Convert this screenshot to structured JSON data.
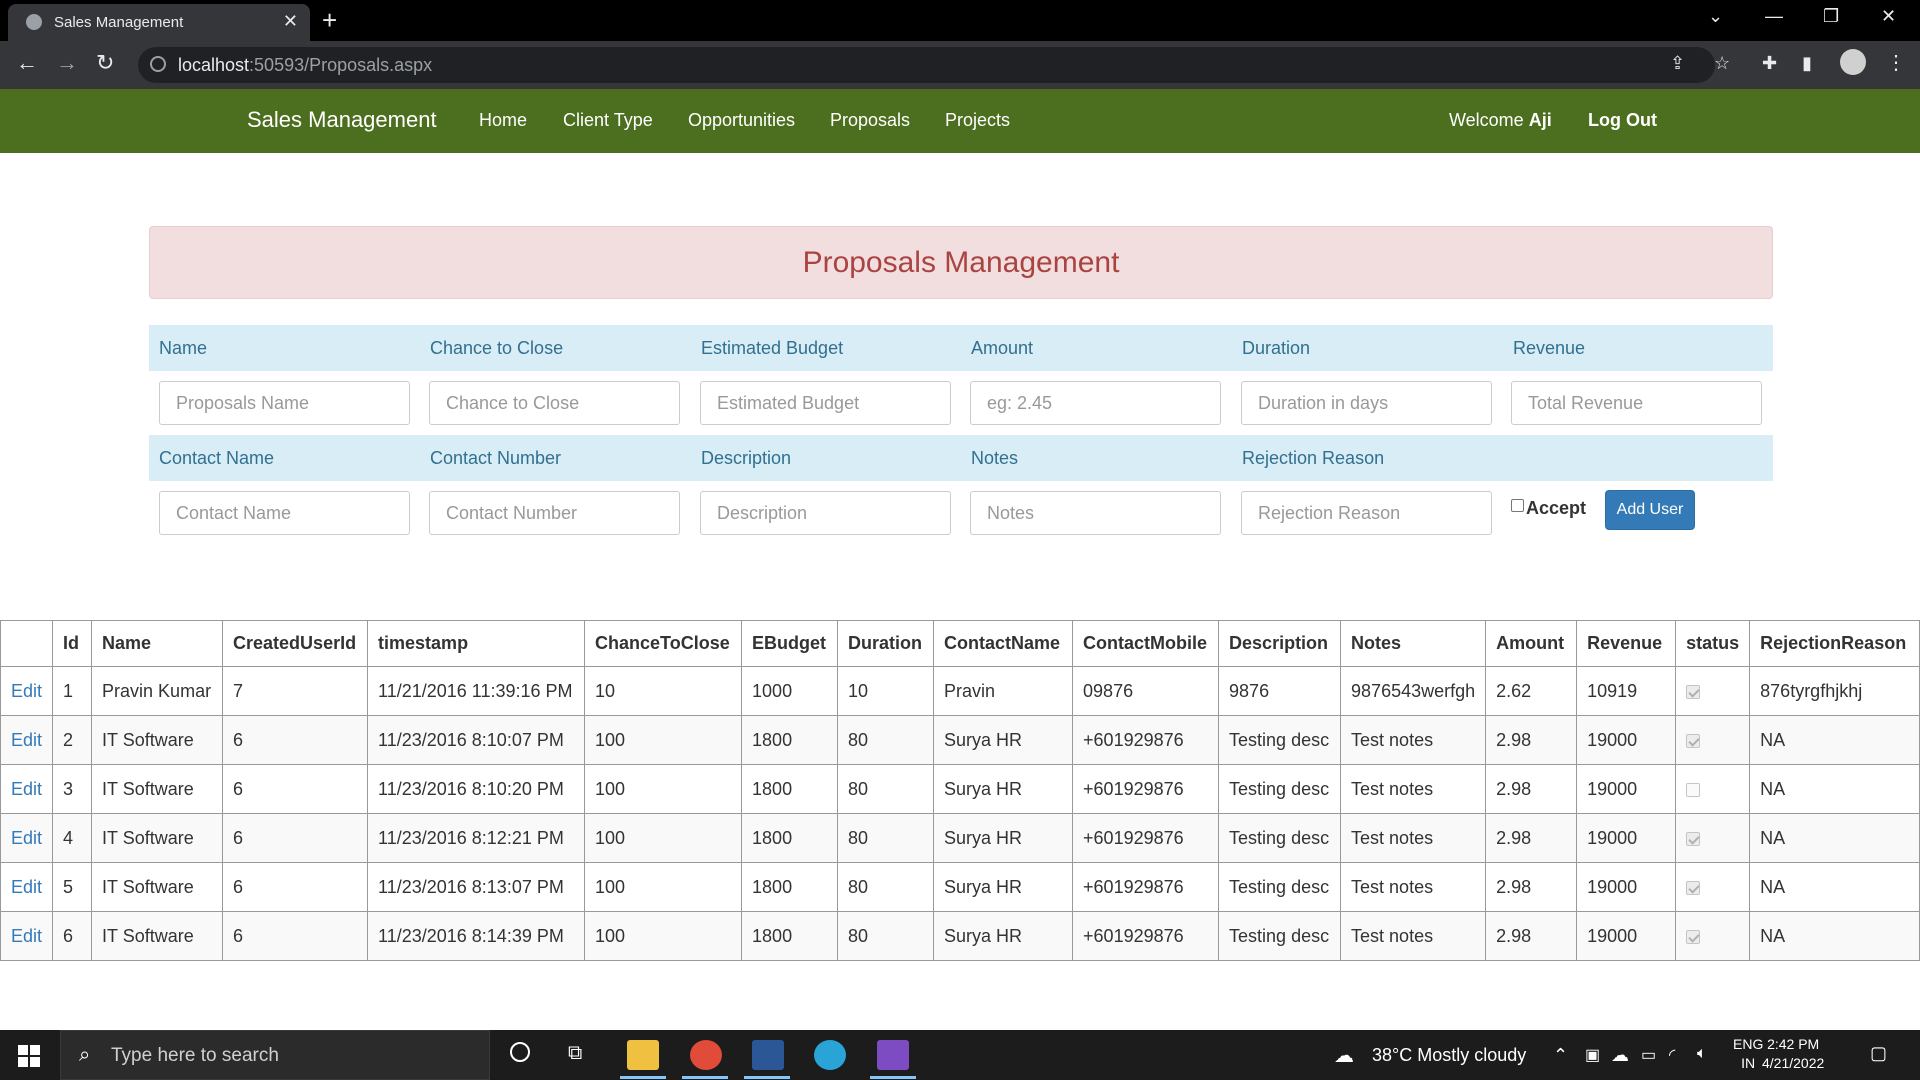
{
  "browser": {
    "tab_title": "Sales Management",
    "url_host": "localhost",
    "url_rest": ":50593/Proposals.aspx"
  },
  "app": {
    "brand": "Sales Management",
    "nav": [
      "Home",
      "Client Type",
      "Opportunities",
      "Proposals",
      "Projects"
    ],
    "welcome_prefix": "Welcome",
    "user_name": "Aji",
    "logout": "Log Out",
    "nav_bg": "#4b6f1e"
  },
  "page": {
    "heading": "Proposals Management"
  },
  "form": {
    "row1_labels": [
      "Name",
      "Chance to Close",
      "Estimated Budget",
      "Amount",
      "Duration",
      "Revenue"
    ],
    "row1_placeholders": [
      "Proposals Name",
      "Chance to Close",
      "Estimated Budget",
      "eg: 2.45",
      "Duration in days",
      "Total Revenue"
    ],
    "row2_labels": [
      "Contact Name",
      "Contact Number",
      "Description",
      "Notes",
      "Rejection Reason"
    ],
    "row2_placeholders": [
      "Contact Name",
      "Contact Number",
      "Description",
      "Notes",
      "Rejection Reason"
    ],
    "accept_label": "Accept",
    "accept_checked": false,
    "add_button": "Add User"
  },
  "table": {
    "edit_label": "Edit",
    "headers": [
      "",
      "Id",
      "Name",
      "CreatedUserId",
      "timestamp",
      "ChanceToClose",
      "EBudget",
      "Duration",
      "ContactName",
      "ContactMobile",
      "Description",
      "Notes",
      "Amount",
      "Revenue",
      "status",
      "RejectionReason"
    ],
    "rows": [
      {
        "id": "1",
        "name": "Pravin Kumar",
        "created": "7",
        "timestamp": "11/21/2016 11:39:16 PM",
        "chance": "10",
        "ebudget": "1000",
        "duration": "10",
        "contact": "Pravin",
        "mobile": "09876",
        "description": "9876",
        "notes": "9876543werfgh",
        "amount": "2.62",
        "revenue": "10919",
        "status": true,
        "rejection": "876tyrgfhjkhj"
      },
      {
        "id": "2",
        "name": "IT Software",
        "created": "6",
        "timestamp": "11/23/2016 8:10:07 PM",
        "chance": "100",
        "ebudget": "1800",
        "duration": "80",
        "contact": "Surya HR",
        "mobile": "+601929876",
        "description": "Testing desc",
        "notes": "Test notes",
        "amount": "2.98",
        "revenue": "19000",
        "status": true,
        "rejection": "NA"
      },
      {
        "id": "3",
        "name": "IT Software",
        "created": "6",
        "timestamp": "11/23/2016 8:10:20 PM",
        "chance": "100",
        "ebudget": "1800",
        "duration": "80",
        "contact": "Surya HR",
        "mobile": "+601929876",
        "description": "Testing desc",
        "notes": "Test notes",
        "amount": "2.98",
        "revenue": "19000",
        "status": false,
        "rejection": "NA"
      },
      {
        "id": "4",
        "name": "IT Software",
        "created": "6",
        "timestamp": "11/23/2016 8:12:21 PM",
        "chance": "100",
        "ebudget": "1800",
        "duration": "80",
        "contact": "Surya HR",
        "mobile": "+601929876",
        "description": "Testing desc",
        "notes": "Test notes",
        "amount": "2.98",
        "revenue": "19000",
        "status": true,
        "rejection": "NA"
      },
      {
        "id": "5",
        "name": "IT Software",
        "created": "6",
        "timestamp": "11/23/2016 8:13:07 PM",
        "chance": "100",
        "ebudget": "1800",
        "duration": "80",
        "contact": "Surya HR",
        "mobile": "+601929876",
        "description": "Testing desc",
        "notes": "Test notes",
        "amount": "2.98",
        "revenue": "19000",
        "status": true,
        "rejection": "NA"
      },
      {
        "id": "6",
        "name": "IT Software",
        "created": "6",
        "timestamp": "11/23/2016 8:14:39 PM",
        "chance": "100",
        "ebudget": "1800",
        "duration": "80",
        "contact": "Surya HR",
        "mobile": "+601929876",
        "description": "Testing desc",
        "notes": "Test notes",
        "amount": "2.98",
        "revenue": "19000",
        "status": true,
        "rejection": "NA"
      }
    ]
  },
  "taskbar": {
    "search_placeholder": "Type here to search",
    "weather": "38°C  Mostly cloudy",
    "lang_line1": "ENG",
    "lang_line2": "IN",
    "time": "2:42 PM",
    "date": "4/21/2022"
  }
}
